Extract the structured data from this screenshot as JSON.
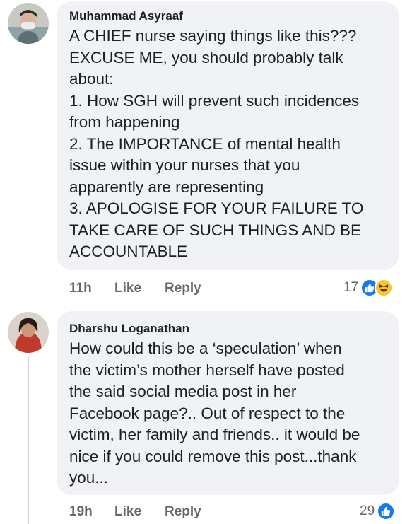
{
  "comments": [
    {
      "author": "Muhammad Asyraaf",
      "text": "A CHIEF nurse saying things like this???\nEXCUSE ME, you should probably talk\nabout:\n1. How SGH will prevent such incidences\nfrom happening\n2. The IMPORTANCE of mental health\nissue within your nurses that you\napparently are representing\n3. APOLOGISE FOR YOUR FAILURE TO\nTAKE CARE OF SUCH THINGS AND BE\nACCOUNTABLE",
      "time": "11h",
      "like_label": "Like",
      "reply_label": "Reply",
      "reaction_count": "17",
      "reactions": [
        "like-icon",
        "haha-icon"
      ]
    },
    {
      "author": "Dharshu Loganathan",
      "text": "How could this be a ‘speculation’ when\nthe victim’s mother herself have posted\nthe said social media post in her\nFacebook page?.. Out of respect to the\nvictim, her family and friends.. it would be\nnice if you could remove this post...thank\nyou...",
      "time": "19h",
      "like_label": "Like",
      "reply_label": "Reply",
      "reaction_count": "29",
      "reactions": [
        "like-icon"
      ]
    }
  ],
  "colors": {
    "bubble": "#f0f2f5",
    "meta_text": "#65676b",
    "like_blue": "#1877f2",
    "haha_yellow": "#f7c531"
  }
}
